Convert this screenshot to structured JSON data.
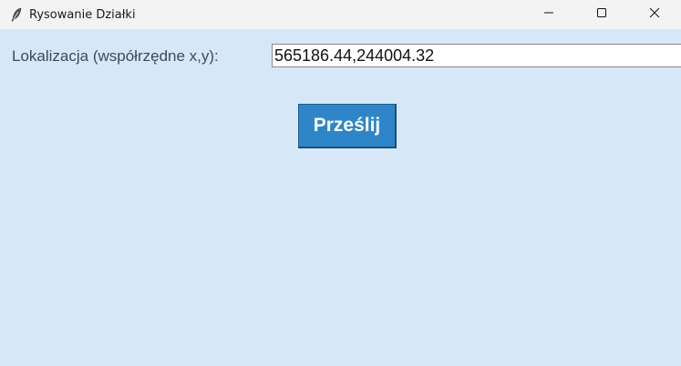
{
  "window": {
    "title": "Rysowanie Działki",
    "icon": "feather-icon"
  },
  "controls": {
    "minimize_icon": "minimize-icon",
    "maximize_icon": "maximize-icon",
    "close_icon": "close-icon"
  },
  "form": {
    "location_label": "Lokalizacja (współrzędne x,y):",
    "location_value": "565186.44,244004.32",
    "submit_label": "Prześlij"
  },
  "colors": {
    "background": "#d6e8f7",
    "titlebar": "#f3f3f3",
    "button": "#2e86c8",
    "button_text": "#ffffff"
  }
}
